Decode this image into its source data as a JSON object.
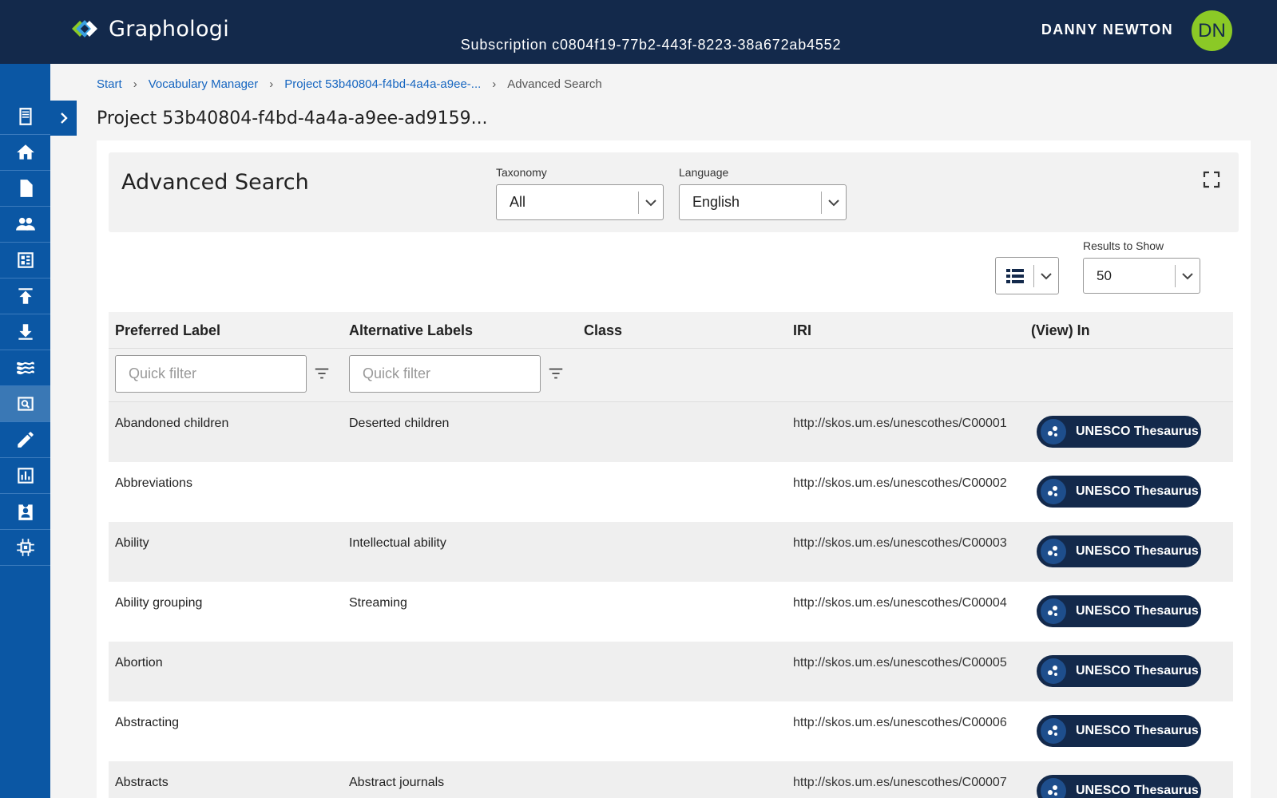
{
  "header": {
    "app_name": "Graphologi",
    "subscription": "Subscription c0804f19-77b2-443f-8223-38a672ab4552",
    "user_name": "DANNY NEWTON",
    "user_initials": "DN"
  },
  "breadcrumb": {
    "start": "Start",
    "vocab": "Vocabulary Manager",
    "project": "Project 53b40804-f4bd-4a4a-a9ee-...",
    "current": "Advanced Search"
  },
  "page_title": "Project 53b40804-f4bd-4a4a-a9ee-ad9159...",
  "search": {
    "title": "Advanced Search",
    "taxonomy_label": "Taxonomy",
    "taxonomy_value": "All",
    "language_label": "Language",
    "language_value": "English",
    "results_label": "Results to Show",
    "results_value": "50"
  },
  "columns": {
    "preferred": "Preferred Label",
    "alternative": "Alternative Labels",
    "class": "Class",
    "iri": "IRI",
    "view_in": "(View) In"
  },
  "filters": {
    "placeholder": "Quick filter"
  },
  "rows": [
    {
      "pref": "Abandoned children",
      "alt": "Deserted children",
      "iri": "http://skos.um.es/unescothes/C00001",
      "view": "UNESCO Thesaurus"
    },
    {
      "pref": "Abbreviations",
      "alt": "",
      "iri": "http://skos.um.es/unescothes/C00002",
      "view": "UNESCO Thesaurus"
    },
    {
      "pref": "Ability",
      "alt": "Intellectual ability",
      "iri": "http://skos.um.es/unescothes/C00003",
      "view": "UNESCO Thesaurus"
    },
    {
      "pref": "Ability grouping",
      "alt": "Streaming",
      "iri": "http://skos.um.es/unescothes/C00004",
      "view": "UNESCO Thesaurus"
    },
    {
      "pref": "Abortion",
      "alt": "",
      "iri": "http://skos.um.es/unescothes/C00005",
      "view": "UNESCO Thesaurus"
    },
    {
      "pref": "Abstracting",
      "alt": "",
      "iri": "http://skos.um.es/unescothes/C00006",
      "view": "UNESCO Thesaurus"
    },
    {
      "pref": "Abstracts",
      "alt": "Abstract journals",
      "iri": "http://skos.um.es/unescothes/C00007",
      "view": "UNESCO Thesaurus"
    }
  ],
  "colors": {
    "header_bg": "#13294b",
    "sidebar_bg": "#0b57a4",
    "accent_green": "#8bc926",
    "link_blue": "#1565c0"
  },
  "sidebar_icons": [
    "document-icon",
    "home-icon",
    "file-icon",
    "people-icon",
    "dashboard-icon",
    "upload-icon",
    "download-icon",
    "waves-icon",
    "search-icon",
    "edit-icon",
    "chart-icon",
    "badge-icon",
    "chip-icon"
  ]
}
